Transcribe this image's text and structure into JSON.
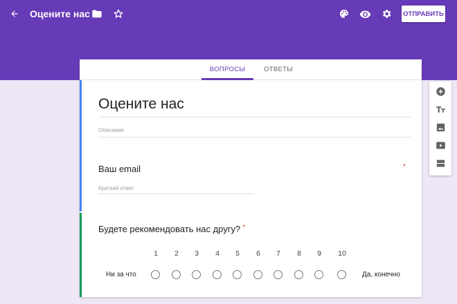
{
  "header": {
    "title": "Оцените нас",
    "send_label": "ОТПРАВИТЬ",
    "icons": [
      "arrow-back-icon",
      "folder-icon",
      "star-icon",
      "palette-icon",
      "eye-icon",
      "gear-icon"
    ]
  },
  "tabs": [
    {
      "label": "ВОПРОСЫ",
      "active": true
    },
    {
      "label": "ОТВЕТЫ",
      "active": false
    }
  ],
  "form": {
    "title": "Оцените нас",
    "description_placeholder": "Описание"
  },
  "questions": [
    {
      "title": "Ваш email",
      "required_mark": "*",
      "placeholder": "Краткий ответ"
    },
    {
      "title": "Будете рекомендовать нас другу?",
      "required_mark": "*",
      "scale": [
        "1",
        "2",
        "3",
        "4",
        "5",
        "6",
        "7",
        "8",
        "9",
        "10"
      ],
      "low_label": "Ни за что",
      "high_label": "Да, конечно"
    }
  ],
  "sidebar_tools": [
    "add-question-icon",
    "add-title-icon",
    "add-image-icon",
    "add-video-icon",
    "add-section-icon"
  ],
  "colors": {
    "accent": "#673ab7",
    "background": "#ede7f6",
    "required": "#db4437",
    "header_bar": "#4285f4",
    "active_bar": "#0f9d58"
  }
}
